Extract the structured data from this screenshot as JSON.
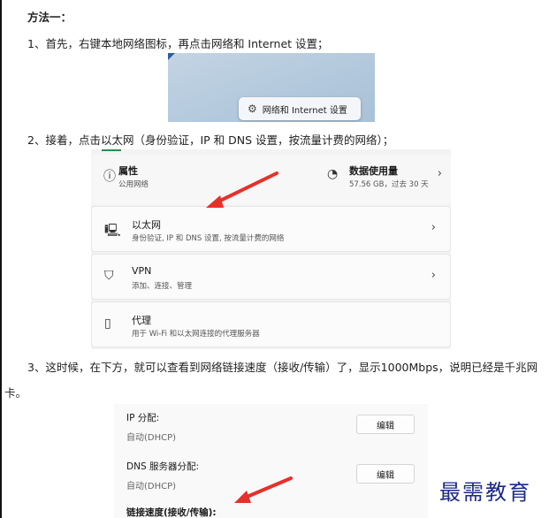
{
  "method_heading": "方法一：",
  "steps": {
    "step1": "1、首先，右键本地网络图标，再点击网络和 Internet 设置；",
    "step2": "2、接着，点击以太网（身份验证，IP 和 DNS 设置，按流量计费的网络）；",
    "step3_line1": "3、这时候，在下方，就可以查看到网络链接速度（接收/传输）了，显示1000Mbps，说明已经是千兆网",
    "step3_line2": "卡。"
  },
  "screenshot1": {
    "context_menu_label": "网络和 Internet 设置",
    "icon": "gear-icon"
  },
  "screenshot2": {
    "properties": {
      "title": "属性",
      "subtitle": "公用网络",
      "icon": "info-icon"
    },
    "data_usage": {
      "title": "数据使用量",
      "subtitle": "57.56 GB，过去 30 天",
      "icon": "pie-chart-icon"
    },
    "ethernet": {
      "title": "以太网",
      "subtitle": "身份验证, IP 和 DNS 设置, 按流量计费的网络",
      "icon": "ethernet-icon"
    },
    "vpn": {
      "title": "VPN",
      "subtitle": "添加、连接、管理",
      "icon": "shield-icon"
    },
    "proxy": {
      "title": "代理",
      "subtitle": "用于 Wi-Fi 和以太网连接的代理服务器",
      "icon": "proxy-icon"
    },
    "chevron": "›"
  },
  "screenshot3": {
    "ip_assign_label": "IP 分配:",
    "ip_assign_value": "自动(DHCP)",
    "dns_assign_label": "DNS 服务器分配:",
    "dns_assign_value": "自动(DHCP)",
    "edit_button": "编辑",
    "link_speed_label": "链接速度(接收/传输):"
  },
  "watermark": "最需教育",
  "colors": {
    "arrow": "#e8302a",
    "watermark": "#1e2a88"
  }
}
